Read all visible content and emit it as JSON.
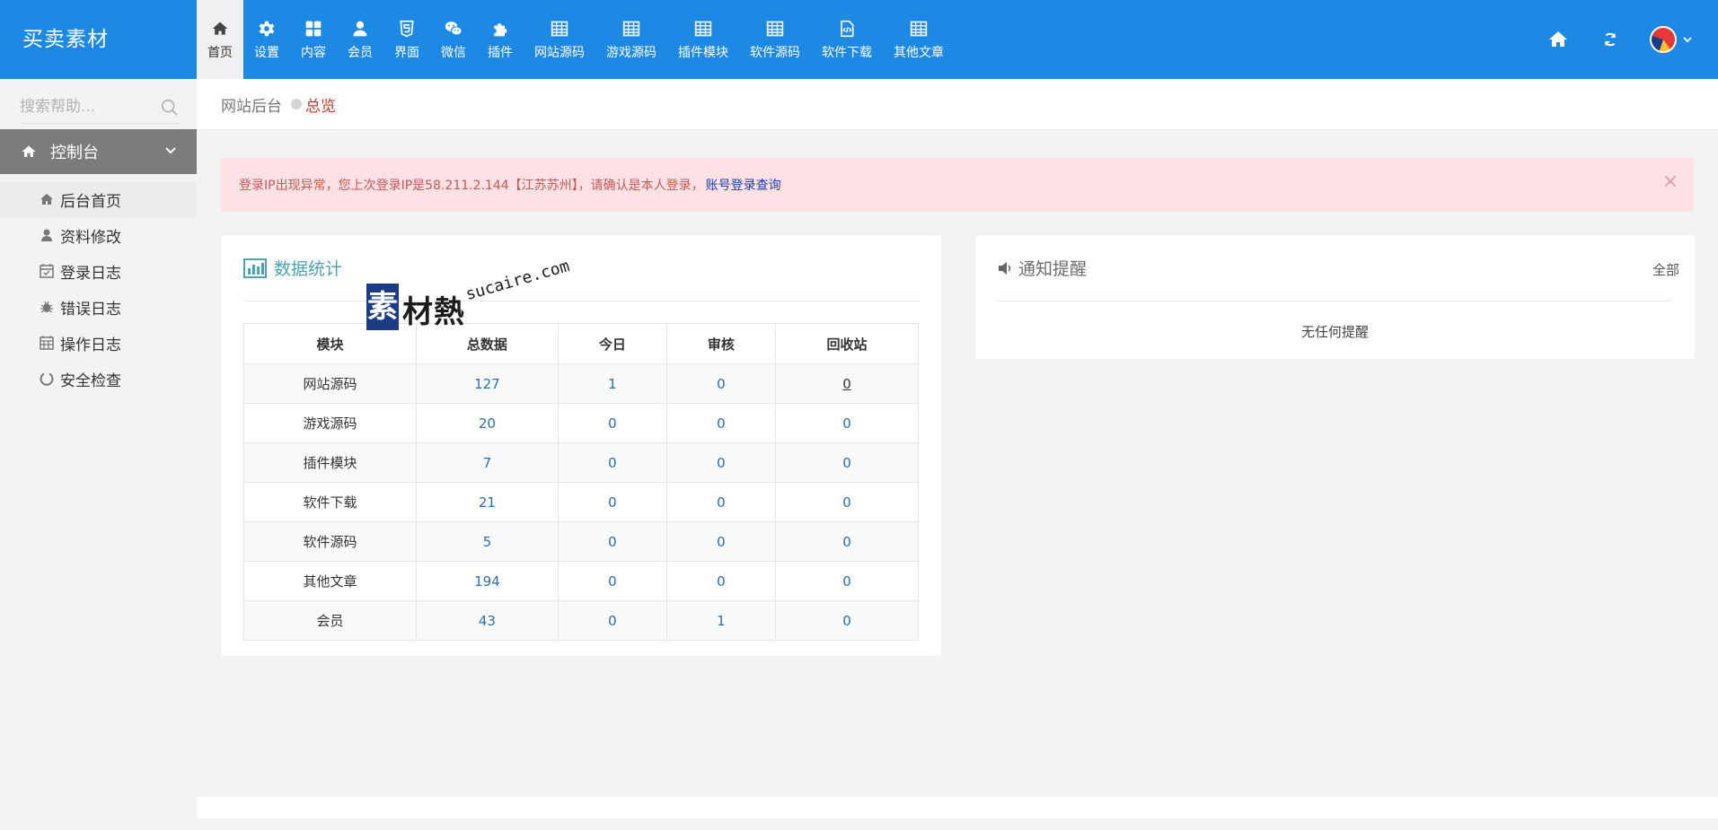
{
  "app": {
    "title": "买卖素材"
  },
  "nav": [
    {
      "label": "首页",
      "icon": "home-icon",
      "active": true
    },
    {
      "label": "设置",
      "icon": "gear-icon"
    },
    {
      "label": "内容",
      "icon": "grid-icon"
    },
    {
      "label": "会员",
      "icon": "user-icon"
    },
    {
      "label": "界面",
      "icon": "html5-icon"
    },
    {
      "label": "微信",
      "icon": "wechat-icon"
    },
    {
      "label": "插件",
      "icon": "puzzle-icon"
    },
    {
      "label": "网站源码",
      "icon": "table-icon"
    },
    {
      "label": "游戏源码",
      "icon": "table-icon"
    },
    {
      "label": "插件模块",
      "icon": "table-icon"
    },
    {
      "label": "软件源码",
      "icon": "table-icon"
    },
    {
      "label": "软件下载",
      "icon": "code-file-icon"
    },
    {
      "label": "其他文章",
      "icon": "table-icon"
    }
  ],
  "topbar_right": {
    "home_icon": "home-icon",
    "refresh_icon": "refresh-icon",
    "avatar": "avatar",
    "dropdown_icon": "chevron-down-icon"
  },
  "sidebar": {
    "search_placeholder": "搜索帮助...",
    "console_label": "控制台",
    "items": [
      {
        "label": "后台首页",
        "icon": "home-icon"
      },
      {
        "label": "资料修改",
        "icon": "user-icon"
      },
      {
        "label": "登录日志",
        "icon": "calendar-check-icon"
      },
      {
        "label": "错误日志",
        "icon": "bug-icon"
      },
      {
        "label": "操作日志",
        "icon": "calendar-icon"
      },
      {
        "label": "安全检查",
        "icon": "circle-notch-icon"
      }
    ]
  },
  "breadcrumb": {
    "root": "网站后台",
    "current": "总览"
  },
  "alert": {
    "message": "登录IP出现异常，您上次登录IP是58.211.2.144【江苏苏州】，请确认是本人登录，",
    "link": "账号登录查询",
    "close": "×"
  },
  "stats_panel": {
    "title": "数据统计",
    "columns": [
      "模块",
      "总数据",
      "今日",
      "审核",
      "回收站"
    ],
    "rows": [
      [
        "网站源码",
        "127",
        "1",
        "0",
        "0"
      ],
      [
        "游戏源码",
        "20",
        "0",
        "0",
        "0"
      ],
      [
        "插件模块",
        "7",
        "0",
        "0",
        "0"
      ],
      [
        "软件下载",
        "21",
        "0",
        "0",
        "0"
      ],
      [
        "软件源码",
        "5",
        "0",
        "0",
        "0"
      ],
      [
        "其他文章",
        "194",
        "0",
        "0",
        "0"
      ],
      [
        "会员",
        "43",
        "0",
        "1",
        "0"
      ]
    ]
  },
  "notice_panel": {
    "title": "通知提醒",
    "all": "全部",
    "empty": "无任何提醒"
  },
  "watermark": {
    "block": "素",
    "zh": "材熱",
    "en": "sucaire.com"
  },
  "colors": {
    "primary": "#1e88e5",
    "alert_bg": "#fde1e4",
    "alert_text": "#c45858",
    "link": "#1a3fa8",
    "stat_title": "#4aa3b2"
  }
}
